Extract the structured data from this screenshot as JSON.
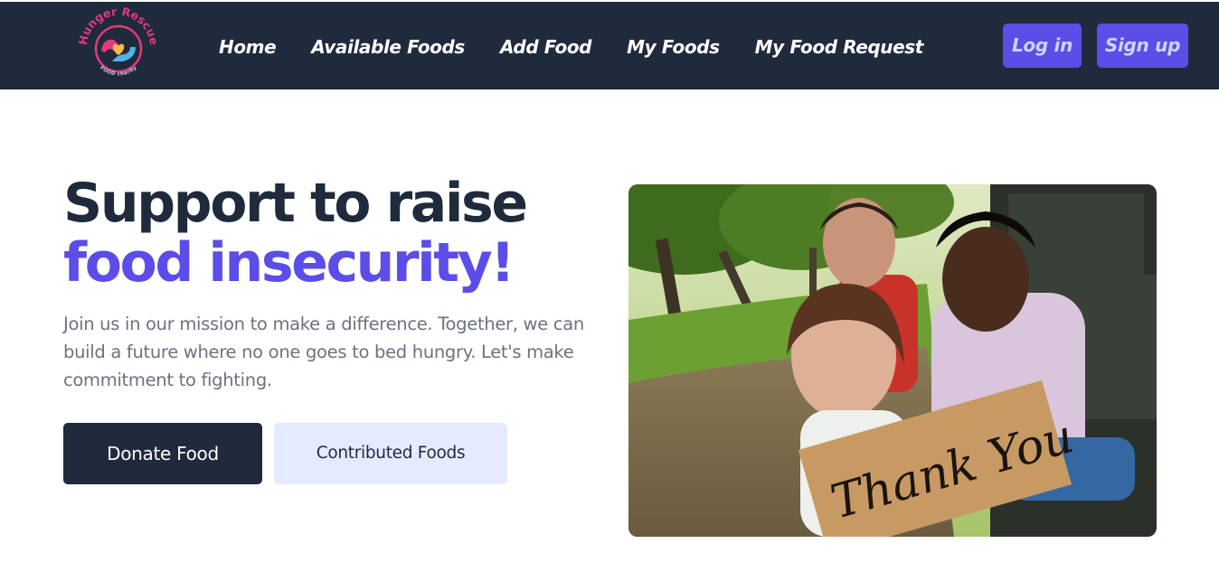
{
  "navbar": {
    "logo": {
      "brand_text": "Hunger Rescue",
      "tagline": "FOOD charity",
      "icon": "heart-hands-icon"
    },
    "links": [
      "Home",
      "Available Foods",
      "Add Food",
      "My Foods",
      "My Food Request"
    ],
    "login_label": "Log in",
    "signup_label": "Sign up"
  },
  "hero": {
    "title_line1": "Support to raise",
    "title_line2": "food insecurity!",
    "description": "Join us in our mission to make a difference. Together, we can build a future where no one goes to bed hungry. Let's make commitment to fighting.",
    "donate_label": "Donate Food",
    "contributed_label": "Contributed Foods",
    "image": {
      "sign_text": "Thank You"
    }
  },
  "colors": {
    "navbar_bg": "#1f2a3c",
    "accent": "#5b4de8",
    "secondary_button_bg": "#e6eafe",
    "body_text": "#6b7280"
  }
}
